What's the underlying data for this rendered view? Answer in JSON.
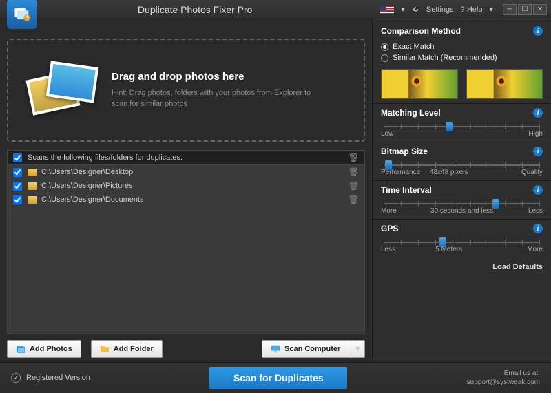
{
  "titlebar": {
    "app_title": "Duplicate Photos Fixer Pro",
    "settings": "Settings",
    "help": "? Help",
    "flag_dd": "▾",
    "help_dd": "▾"
  },
  "dropzone": {
    "heading": "Drag and drop photos here",
    "hint": "Hint: Drag photos, folders with your photos from Explorer to scan for similar photos"
  },
  "list": {
    "header": "Scans the following files/folders for duplicates.",
    "rows": [
      {
        "path": "C:\\Users\\Designer\\Desktop"
      },
      {
        "path": "C:\\Users\\Designer\\Pictures"
      },
      {
        "path": "C:\\Users\\Designer\\Documents"
      }
    ]
  },
  "buttons": {
    "add_photos": "Add Photos",
    "add_folder": "Add Folder",
    "scan_computer": "Scan Computer"
  },
  "right": {
    "comp_method": "Comparison Method",
    "exact": "Exact Match",
    "similar": "Similar Match (Recommended)",
    "matching_level": "Matching Level",
    "ml_low": "Low",
    "ml_high": "High",
    "bitmap_size": "Bitmap Size",
    "bs_low": "Performance",
    "bs_mid": "48x48 pixels",
    "bs_high": "Quality",
    "time_interval": "Time Interval",
    "ti_low": "More",
    "ti_mid": "30 seconds and less",
    "ti_high": "Less",
    "gps": "GPS",
    "gps_low": "Less",
    "gps_mid": "5 Meters",
    "gps_high": "More",
    "load_defaults": "Load Defaults"
  },
  "footer": {
    "registered": "Registered Version",
    "scan": "Scan for Duplicates",
    "email_label": "Email us at:",
    "email": "support@systweak.com"
  }
}
